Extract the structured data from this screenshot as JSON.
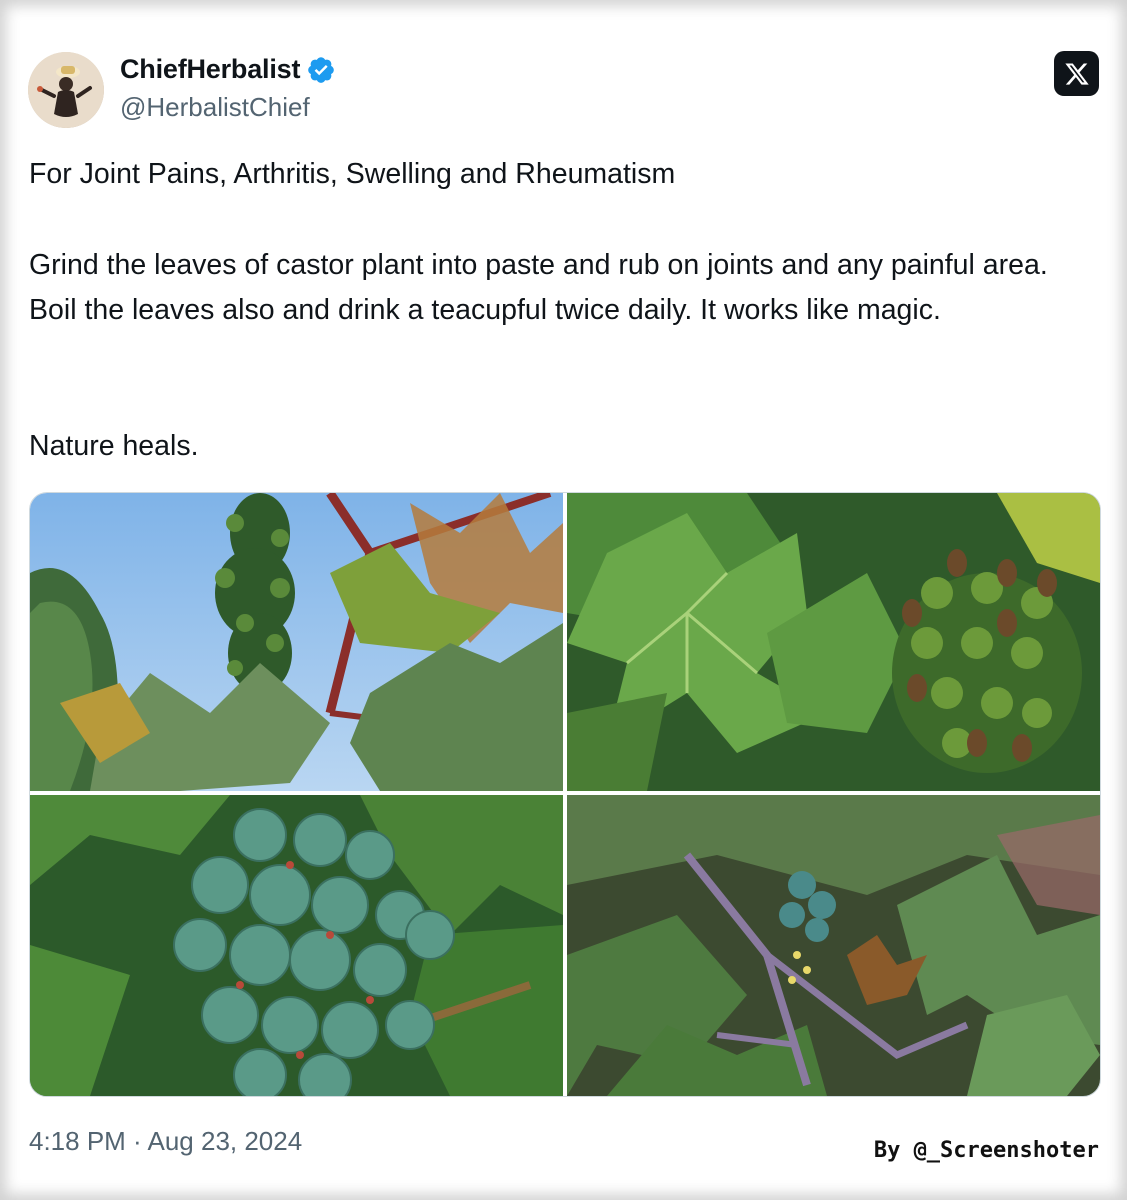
{
  "author": {
    "display_name": "ChiefHerbalist",
    "handle": "@HerbalistChief",
    "verified": true,
    "avatar_icon": "avatar-icon"
  },
  "platform_icon": "x-logo-icon",
  "post": {
    "title_line": "For Joint Pains, Arthritis, Swelling and Rheumatism",
    "body": "Grind the leaves of castor plant into paste and rub on joints and any painful area. Boil the leaves also and drink a teacupful twice daily. It works like magic.",
    "closing": "Nature heals."
  },
  "media": {
    "images": [
      {
        "subject": "castor plant against blue sky"
      },
      {
        "subject": "castor leaves and seed pods"
      },
      {
        "subject": "spiky green castor fruit cluster"
      },
      {
        "subject": "castor plant with red stems and flowers"
      }
    ]
  },
  "timestamp": "4:18 PM · Aug 23, 2024",
  "credit": "By @_Screenshoter",
  "colors": {
    "text_primary": "#0f1419",
    "text_secondary": "#536471",
    "verified_blue": "#1d9bf0",
    "border": "#cfd9de"
  }
}
